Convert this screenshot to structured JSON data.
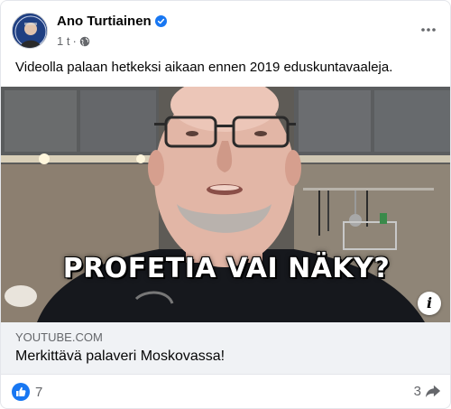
{
  "post": {
    "author": "Ano Turtiainen",
    "time": "1 t",
    "text": "Videolla palaan hetkeksi aikaan ennen 2019 eduskuntavaaleja."
  },
  "video": {
    "headline": "PROFETIA VAI NÄKY?",
    "info_label": "i"
  },
  "link": {
    "domain": "YOUTUBE.COM",
    "title": "Merkittävä palaveri Moskovassa!"
  },
  "footer": {
    "reaction_count": "7",
    "share_count": "3"
  },
  "icons": {
    "verified": "verified-badge-icon",
    "audience": "globe-icon",
    "more": "more-horizontal-icon",
    "like": "like-icon",
    "share": "share-arrow-icon",
    "info": "info-icon"
  },
  "colors": {
    "accent": "#1877f2",
    "secondary_text": "#65676b",
    "link_background": "#f0f2f5"
  }
}
